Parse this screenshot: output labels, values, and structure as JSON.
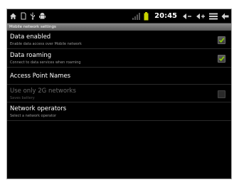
{
  "status_bar": {
    "time": "20:45",
    "left_icons": [
      "home-icon",
      "sd-card-icon",
      "usb-icon",
      "android-debug-icon"
    ],
    "right_icons": [
      "signal-icon",
      "battery-icon"
    ],
    "nav_icons": [
      "volume-down-icon",
      "volume-up-icon",
      "menu-icon",
      "back-icon"
    ],
    "battery_color": "#c8d400"
  },
  "header": {
    "title": "Mobile network settings"
  },
  "settings": [
    {
      "title": "Data enabled",
      "summary": "Enable data access over Mobile network",
      "checked": true,
      "enabled": true
    },
    {
      "title": "Data roaming",
      "summary": "Connect to data services when roaming",
      "checked": true,
      "enabled": true
    },
    {
      "title": "Access Point Names",
      "summary": "",
      "checked": null,
      "enabled": true
    },
    {
      "title": "Use only 2G networks",
      "summary": "Saves battery",
      "checked": false,
      "enabled": false
    },
    {
      "title": "Network operators",
      "summary": "Select a network operator",
      "checked": null,
      "enabled": true
    }
  ],
  "colors": {
    "background": "#000000",
    "checkmark": "#8ed400",
    "header_bg": "#707070"
  }
}
